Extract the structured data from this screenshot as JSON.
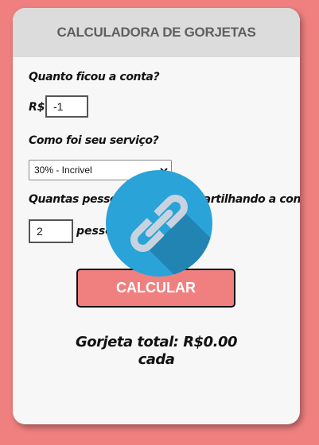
{
  "header": {
    "title": "CALCULADORA DE GORJETAS"
  },
  "form": {
    "bill_question": "Quanto ficou a conta?",
    "currency_symbol": "R$",
    "bill_value": "-1",
    "service_question": "Como foi seu serviço?",
    "service_selected": "30% - Incrivel",
    "people_question": "Quantas pessoas estão compartilhando a conta?",
    "people_value": "2",
    "people_label": "pessoas",
    "calculate_label": "CALCULAR"
  },
  "result": {
    "total_text": "Gorjeta total: R$0.00",
    "each_text": "cada"
  },
  "overlay": {
    "icon": "link-icon",
    "circle_color": "#29a3d8",
    "shadow_color": "#2184b3",
    "chain_color": "#c9d3df"
  },
  "colors": {
    "background": "#f08080",
    "card": "#f7f7f7",
    "header": "#dcdcdc",
    "button": "#f08080"
  }
}
